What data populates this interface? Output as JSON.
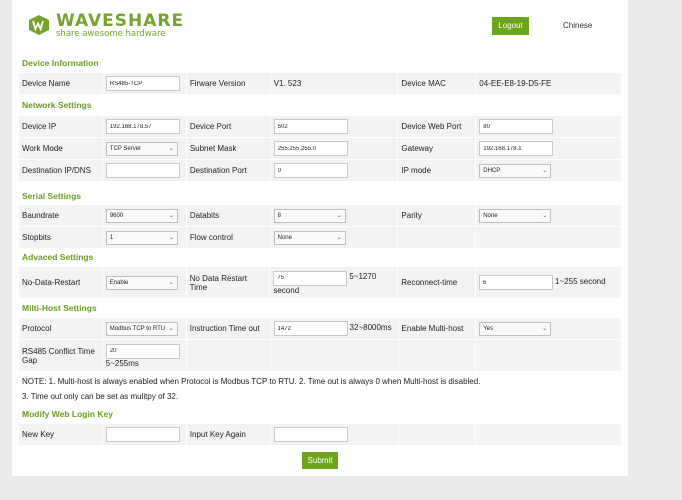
{
  "brand": {
    "name": "WAVESHARE",
    "tagline": "share awesome hardware",
    "accent": "#6aa51b"
  },
  "header": {
    "logout_label": "Logout",
    "language_label": "Chinese"
  },
  "device_information": {
    "title": "Device Information",
    "device_name_label": "Device Name",
    "device_name_value": "RS485-TCP",
    "firmware_label": "Firware Version",
    "firmware_value": "V1. 523",
    "mac_label": "Device MAC",
    "mac_value": "04-EE-E8-19-D5-FE"
  },
  "network_settings": {
    "title": "Network Settings",
    "device_ip_label": "Device IP",
    "device_ip_value": "192.168.178.57",
    "device_port_label": "Device Port",
    "device_port_value": "502",
    "web_port_label": "Device Web Port",
    "web_port_value": "80",
    "work_mode_label": "Work Mode",
    "work_mode_value": "TCP Server",
    "subnet_label": "Subnet Mask",
    "subnet_value": "255.255.255.0",
    "gateway_label": "Gateway",
    "gateway_value": "192.168.178.1",
    "dest_ip_label": "Destination IP/DNS",
    "dest_ip_value": "",
    "dest_port_label": "Destination Port",
    "dest_port_value": "0",
    "ip_mode_label": "IP mode",
    "ip_mode_value": "DHCP"
  },
  "serial_settings": {
    "title": "Serial Settings",
    "baudrate_label": "Baundrate",
    "baudrate_value": "9600",
    "databits_label": "Databits",
    "databits_value": "8",
    "parity_label": "Parity",
    "parity_value": "None",
    "stopbits_label": "Stopbits",
    "stopbits_value": "1",
    "flow_label": "Flow control",
    "flow_value": "None"
  },
  "advanced_settings": {
    "title": "Advaced Settings",
    "no_data_restart_label": "No-Data-Restart",
    "no_data_restart_value": "Enable",
    "no_data_time_label": "No Data Restart Time",
    "no_data_time_value": "75",
    "no_data_time_range": "5~1270",
    "no_data_time_unit": "second",
    "reconnect_label": "Reconnect-time",
    "reconnect_value": "6",
    "reconnect_range": "1~255 second"
  },
  "multi_host_settings": {
    "title": "Milti-Host Settings",
    "protocol_label": "Protocol",
    "protocol_value": "Modbus TCP to RTU",
    "instr_timeout_label": "Instruction Time out",
    "instr_timeout_value": "1472",
    "instr_timeout_range": "32~8000ms",
    "enable_multi_label": "Enable Multi-host",
    "enable_multi_value": "Yes",
    "conflict_label_1": "RS485 Conflict Time",
    "conflict_label_2": "Gap",
    "conflict_value": "20",
    "conflict_range": "5~255ms",
    "note_1": "NOTE: 1. Multi-host is always enabled when Protocol is Modbus TCP to RTU. 2. Time out is always 0 when Multi-host is disabled.",
    "note_2": "3. Time out only can be set as mulitpy of 32."
  },
  "login_key": {
    "title": "Modify Web Login Key",
    "new_key_label": "New Key",
    "new_key_value": "",
    "again_label": "Input Key Again",
    "again_value": ""
  },
  "submit_label": "Submit"
}
